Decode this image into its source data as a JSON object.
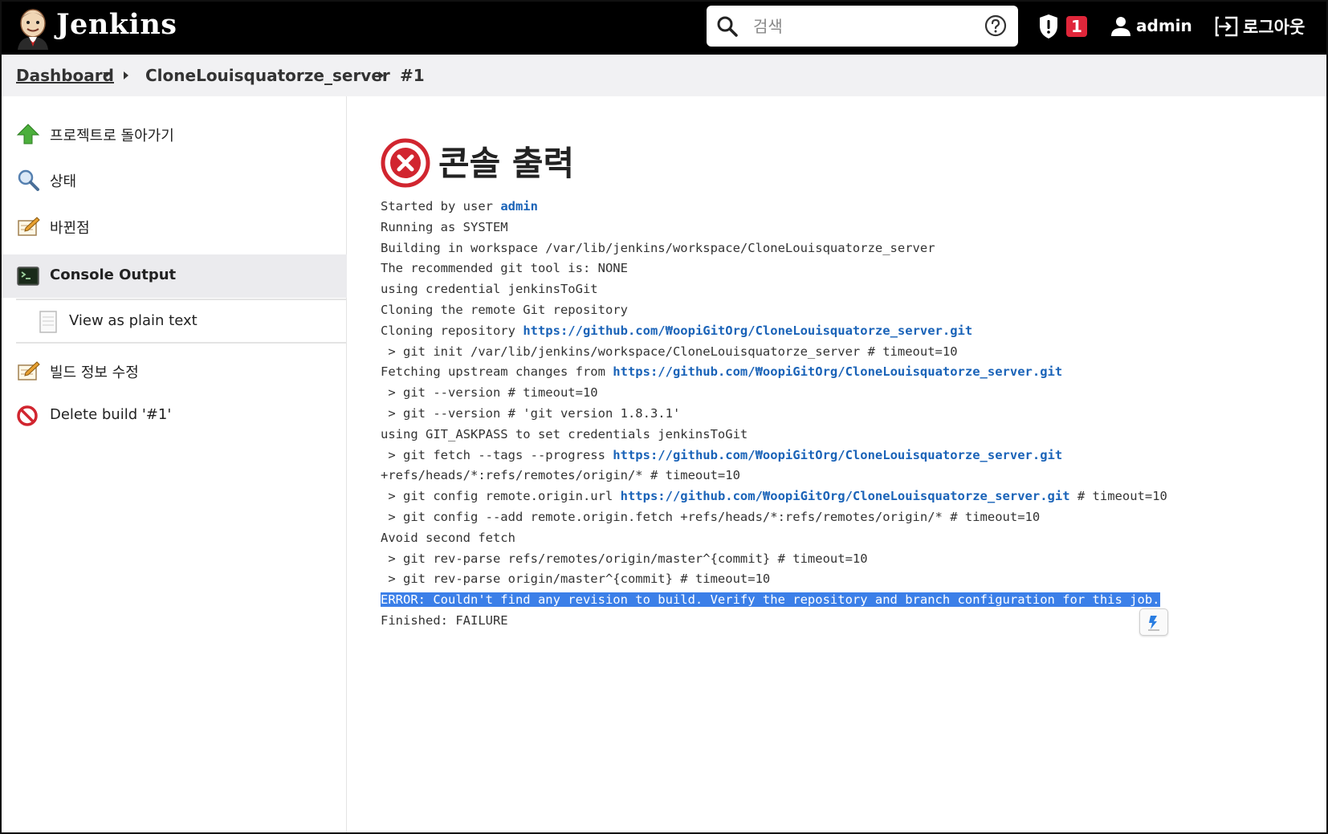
{
  "header": {
    "brand": "Jenkins",
    "search_placeholder": "검색",
    "security_badge_count": "1",
    "user_name": "admin",
    "logout_label": "로그아웃"
  },
  "breadcrumb": {
    "items": [
      "Dashboard",
      "CloneLouisquatorze_server",
      "#1"
    ]
  },
  "sidebar": {
    "items": [
      {
        "label": "프로젝트로 돌아가기",
        "icon": "up-arrow-icon"
      },
      {
        "label": "상태",
        "icon": "magnifier-icon"
      },
      {
        "label": "바뀐점",
        "icon": "notepad-icon"
      },
      {
        "label": "Console Output",
        "icon": "terminal-icon"
      },
      {
        "label": "View as plain text",
        "icon": "document-icon"
      },
      {
        "label": "빌드 정보 수정",
        "icon": "notepad-icon"
      },
      {
        "label": "Delete build '#1'",
        "icon": "no-entry-icon"
      }
    ]
  },
  "main": {
    "title": "콘솔 출력",
    "console_lines": [
      "Started by user ",
      "admin",
      "Running as SYSTEM",
      "Building in workspace /var/lib/jenkins/workspace/CloneLouisquatorze_server",
      "The recommended git tool is: NONE",
      "using credential jenkinsToGit",
      "Cloning the remote Git repository",
      "Cloning repository ",
      "https://github.com/₩oopiGitOrg/CloneLouisquatorze_server.git",
      " > git init /var/lib/jenkins/workspace/CloneLouisquatorze_server # timeout=10",
      "Fetching upstream changes from ",
      " > git --version # timeout=10",
      " > git --version # 'git version 1.8.3.1'",
      "using GIT_ASKPASS to set credentials jenkinsToGit",
      " > git fetch --tags --progress ",
      "+refs/heads/*:refs/remotes/origin/* # timeout=10",
      " > git config remote.origin.url ",
      " # timeout=10",
      " > git config --add remote.origin.fetch +refs/heads/*:refs/remotes/origin/* # timeout=10",
      "Avoid second fetch",
      " > git rev-parse refs/remotes/origin/master^{commit} # timeout=10",
      " > git rev-parse origin/master^{commit} # timeout=10",
      "ERROR: Couldn't find any revision to build. Verify the repository and branch configuration for this job.",
      "Finished: FAILURE"
    ]
  },
  "colors": {
    "header_bg": "#000000",
    "link": "#1a63b8",
    "selection": "#3b7fe8",
    "error_red": "#d1252f",
    "badge_red": "#e0263a"
  }
}
